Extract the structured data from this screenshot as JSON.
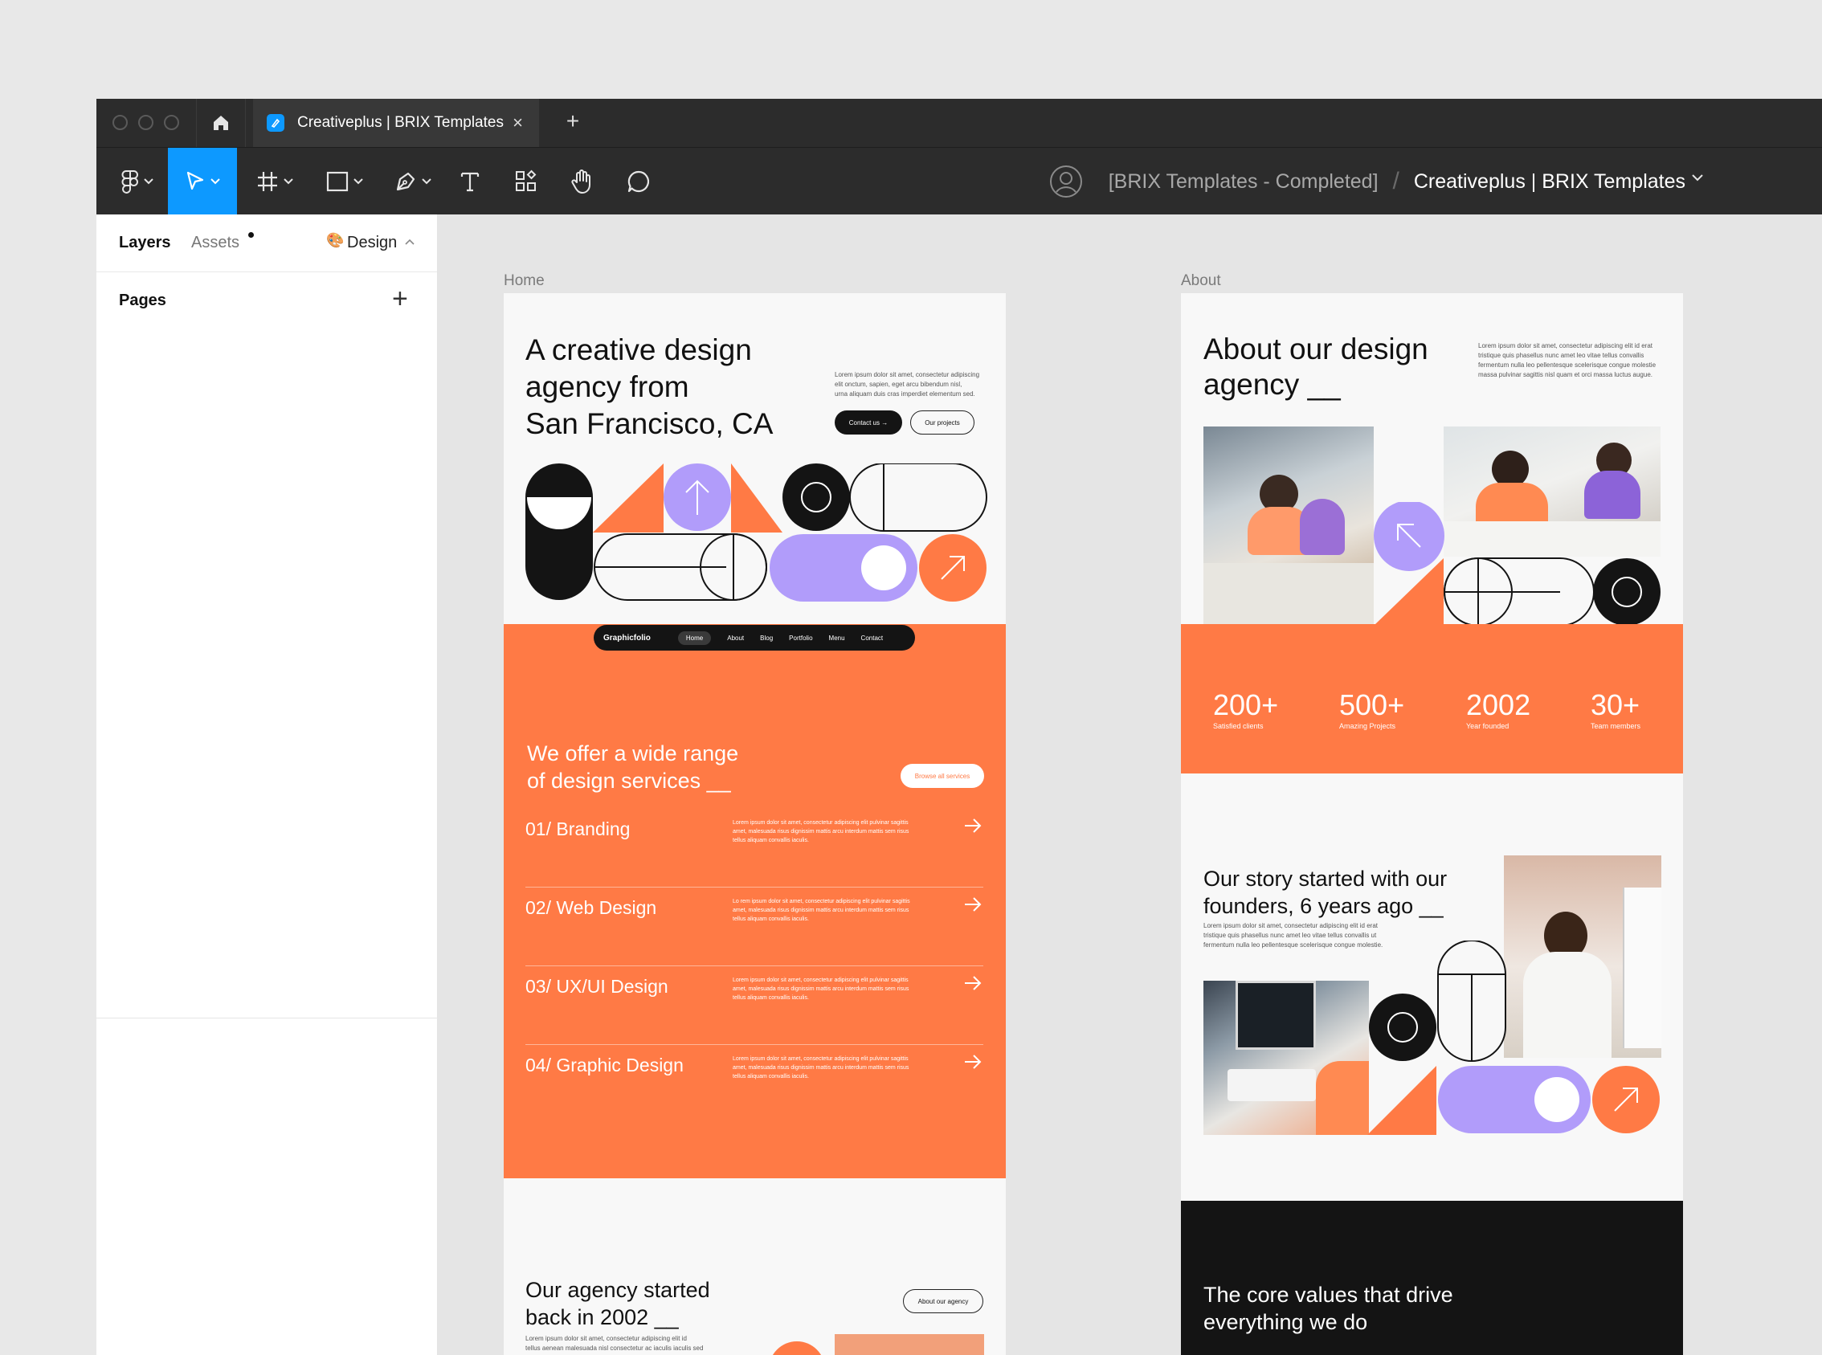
{
  "window": {
    "tab_title": "Creativeplus | BRIX Templates",
    "tab_close": "×",
    "new_tab": "+"
  },
  "toolbar": {
    "breadcrumb_team": "[BRIX Templates - Completed]",
    "breadcrumb_sep": "/",
    "breadcrumb_file": "Creativeplus | BRIX Templates"
  },
  "panel": {
    "tab_layers": "Layers",
    "tab_assets": "Assets",
    "tab_design": "Design",
    "pages_label": "Pages",
    "add_page": "+"
  },
  "colors": {
    "accent": "#0d99ff",
    "orange": "#ff7a45",
    "purple": "#b19cfa",
    "dark": "#141414"
  },
  "home": {
    "frame_label": "Home",
    "hero_title": [
      "A creative design",
      "agency from",
      "San Francisco, CA"
    ],
    "hero_text": [
      "Lorem ipsum dolor sit amet, consectetur adipiscing",
      "elit onctum, sapien, eget arcu bibendum nisl,",
      "urna aliquam duis cras imperdiet elementum sed."
    ],
    "btn_contact": "Contact us →",
    "btn_projects": "Our projects",
    "nav": {
      "logo": "Graphicfolio",
      "items": [
        "Home",
        "About",
        "Blog",
        "Portfolio",
        "Menu",
        "Contact"
      ]
    },
    "services_title": [
      "We offer a wide range",
      "of design services __"
    ],
    "services_btn": "Browse all services",
    "services": [
      {
        "title": "01/ Branding",
        "desc": "Lorem ipsum dolor sit amet, consectetur adipiscing elit pulvinar sagittis amet, malesuada risus dignissim mattis arcu interdum mattis sem risus tellus aliquam convallis iaculis."
      },
      {
        "title": "02/ Web Design",
        "desc": "Lo rem ipsum dolor sit amet, consectetur adipiscing elit pulvinar sagittis amet, malesuada risus dignissim mattis arcu interdum mattis sem risus tellus aliquam convallis iaculis."
      },
      {
        "title": "03/ UX/UI Design",
        "desc": "Lorem ipsum dolor sit amet, consectetur adipiscing elit pulvinar sagittis amet, malesuada risus dignissim mattis arcu interdum mattis sem risus tellus aliquam convallis iaculis."
      },
      {
        "title": "04/ Graphic Design",
        "desc": "Lorem ipsum dolor sit amet, consectetur adipiscing elit pulvinar sagittis amet, malesuada risus dignissim mattis arcu interdum mattis sem risus tellus aliquam convallis iaculis."
      }
    ],
    "agency_title": [
      "Our agency started",
      "back in 2002 __"
    ],
    "agency_btn": "About our agency",
    "agency_text": [
      "Lorem ipsum dolor sit amet, consectetur adipiscing elit id",
      "tellus aenean malesuada nisl consectetur ac iaculis iaculis sed"
    ]
  },
  "about": {
    "frame_label": "About",
    "title": [
      "About our design",
      "agency __"
    ],
    "text": [
      "Lorem ipsum dolor sit amet, consectetur adipiscing elit id erat",
      "tristique quis phasellus nunc amet leo vitae tellus convallis",
      "fermentum nulla leo pellentesque scelerisque congue molestie",
      "massa pulvinar sagittis nisl quam et orci massa luctus augue."
    ],
    "stats": [
      {
        "num": "200+",
        "label": "Satisfied clients"
      },
      {
        "num": "500+",
        "label": "Amazing Projects"
      },
      {
        "num": "2002",
        "label": "Year founded"
      },
      {
        "num": "30+",
        "label": "Team members"
      }
    ],
    "story_title": [
      "Our story started with our",
      "founders, 6 years ago __"
    ],
    "story_text": [
      "Lorem ipsum dolor sit amet, consectetur adipiscing elit id erat",
      "tristique quis phasellus nunc amet leo vitae tellus convallis ut",
      "fermentum nulla leo pellentesque scelerisque congue molestie."
    ],
    "values_title": [
      "The core values that drive",
      "everything we do"
    ]
  }
}
